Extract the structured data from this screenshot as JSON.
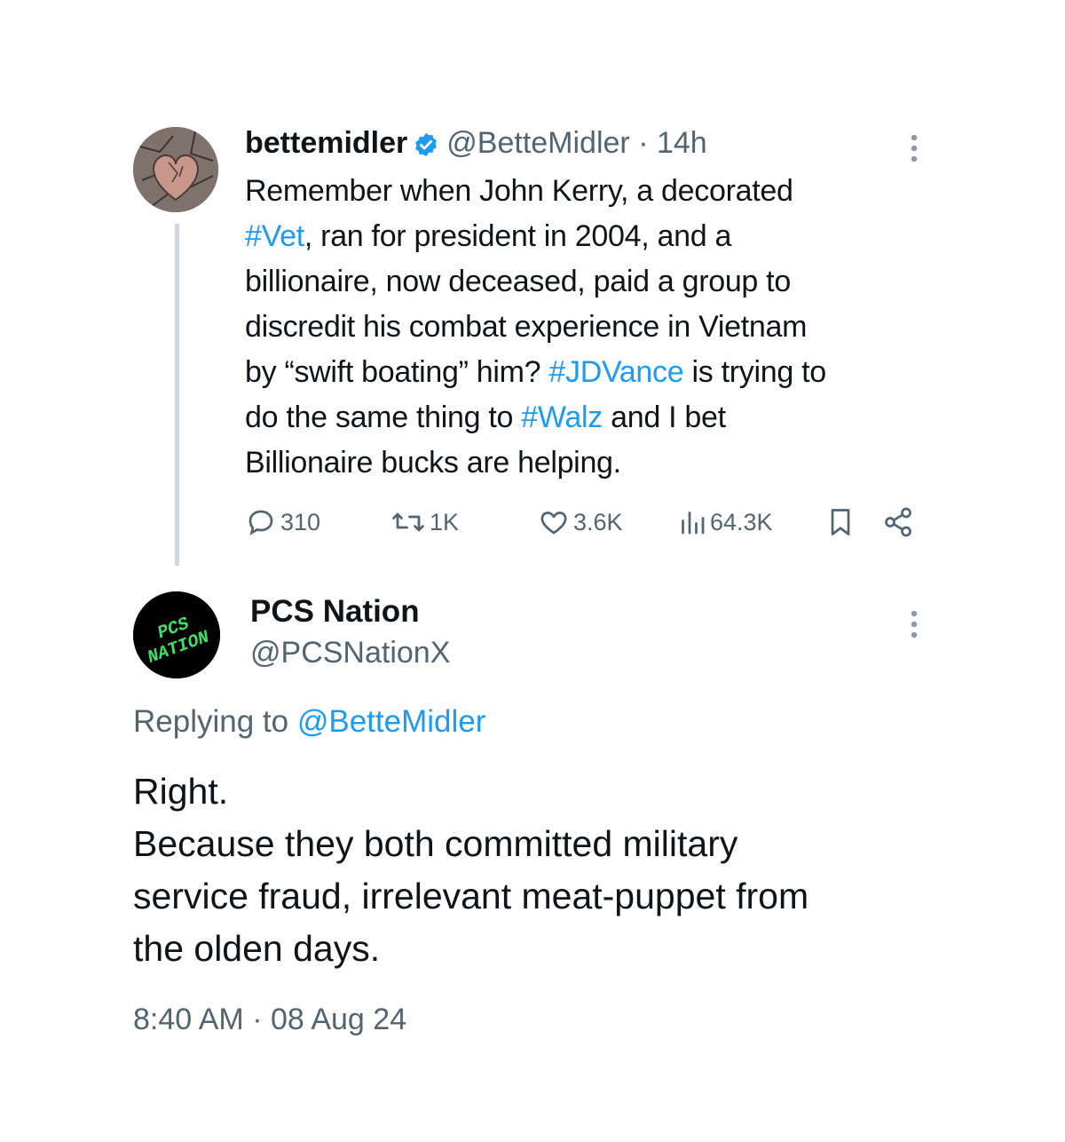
{
  "parent_tweet": {
    "display_name": "bettemidler",
    "handle": "@BetteMidler",
    "separator": " · ",
    "time_ago": "14h",
    "lines": [
      [
        {
          "t": "Remember when John Kerry, a decorated"
        }
      ],
      [
        {
          "t": "#Vet",
          "link": true
        },
        {
          "t": ", ran for president in 2004, and a"
        }
      ],
      [
        {
          "t": "billionaire, now deceased, paid a group to"
        }
      ],
      [
        {
          "t": "discredit his combat experience in Vietnam"
        }
      ],
      [
        {
          "t": "by “swift boating” him? "
        },
        {
          "t": "#JDVance",
          "link": true
        },
        {
          "t": " is trying to"
        }
      ],
      [
        {
          "t": "do the same thing to "
        },
        {
          "t": "#Walz",
          "link": true
        },
        {
          "t": " and I bet"
        }
      ],
      [
        {
          "t": "Billionaire bucks are helping."
        }
      ]
    ],
    "metrics": {
      "replies": "310",
      "retweets": "1K",
      "likes": "3.6K",
      "views": "64.3K"
    }
  },
  "reply": {
    "display_name": "PCS Nation",
    "handle": "@PCSNationX",
    "avatar_text": [
      "PCS",
      "NATION"
    ],
    "replying_prefix": "Replying to ",
    "replying_handle": "@BetteMidler",
    "lines": [
      "Right.",
      "Because they both committed military",
      "service fraud, irrelevant meat-puppet from",
      "the olden days."
    ],
    "timestamp": "8:40 AM · 08 Aug 24"
  },
  "colors": {
    "link": "#1d9bf0",
    "muted": "#536471",
    "text": "#0f1419",
    "thread_line": "#cfd9de",
    "avatar_text_green": "#3fe06a"
  },
  "icons": [
    "verified-badge-icon",
    "more-icon",
    "reply-icon",
    "retweet-icon",
    "like-icon",
    "views-icon",
    "bookmark-icon",
    "share-icon"
  ]
}
